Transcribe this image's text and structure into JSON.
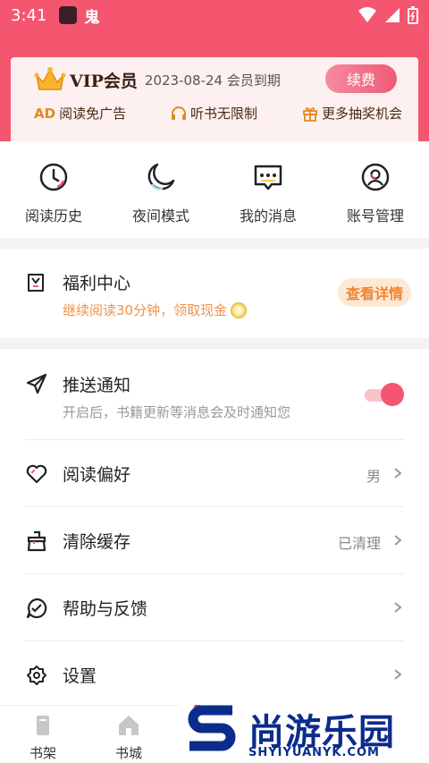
{
  "status_bar": {
    "time": "3:41",
    "app_glyph": "鬼"
  },
  "vip": {
    "title": "VIP会员",
    "expire_text": "2023-08-24 会员到期",
    "renew_label": "续费",
    "perks": [
      {
        "icon": "AD",
        "label": "阅读免广告"
      },
      {
        "icon": "headphones-icon",
        "label": "听书无限制"
      },
      {
        "icon": "gift-icon",
        "label": "更多抽奖机会"
      }
    ]
  },
  "quick_actions": [
    {
      "icon": "clock-icon",
      "label": "阅读历史"
    },
    {
      "icon": "moon-icon",
      "label": "夜间模式"
    },
    {
      "icon": "message-icon",
      "label": "我的消息"
    },
    {
      "icon": "account-icon",
      "label": "账号管理"
    }
  ],
  "welfare": {
    "title": "福利中心",
    "subtitle": "继续阅读30分钟，领取现金",
    "button": "查看详情"
  },
  "settings": {
    "push": {
      "title": "推送通知",
      "subtitle": "开启后，书籍更新等消息会及时通知您",
      "enabled": true
    },
    "items": [
      {
        "icon": "heart-icon",
        "title": "阅读偏好",
        "value": "男"
      },
      {
        "icon": "broom-icon",
        "title": "清除缓存",
        "value": "已清理"
      },
      {
        "icon": "help-icon",
        "title": "帮助与反馈",
        "value": ""
      },
      {
        "icon": "gear-icon",
        "title": "设置",
        "value": ""
      }
    ]
  },
  "tabbar": [
    {
      "icon": "bookshelf-icon",
      "label": "书架"
    },
    {
      "icon": "bookstore-icon",
      "label": "书城"
    }
  ],
  "watermark": {
    "text": "尚游乐园",
    "url": "SHYIYUANYK.COM"
  },
  "colors": {
    "accent": "#f4566f",
    "orange": "#f0842f",
    "watermark": "#0b2c8c"
  }
}
